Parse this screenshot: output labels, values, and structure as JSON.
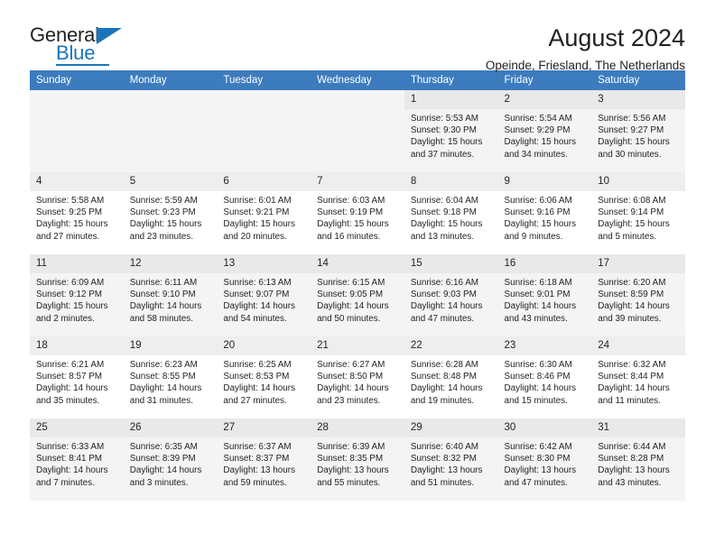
{
  "brand": {
    "name_top": "General",
    "name_bottom": "Blue",
    "accent_color": "#1b75bb",
    "triangle_icon": "triangle-icon"
  },
  "header": {
    "title": "August 2024",
    "subtitle": "Opeinde, Friesland, The Netherlands"
  },
  "calendar": {
    "header_bg": "#3c7cbe",
    "weekday_headers": [
      "Sunday",
      "Monday",
      "Tuesday",
      "Wednesday",
      "Thursday",
      "Friday",
      "Saturday"
    ],
    "weeks": [
      [
        {
          "blank": true
        },
        {
          "blank": true
        },
        {
          "blank": true
        },
        {
          "blank": true
        },
        {
          "day": "1",
          "sunrise": "Sunrise: 5:53 AM",
          "sunset": "Sunset: 9:30 PM",
          "daylight": "Daylight: 15 hours and 37 minutes."
        },
        {
          "day": "2",
          "sunrise": "Sunrise: 5:54 AM",
          "sunset": "Sunset: 9:29 PM",
          "daylight": "Daylight: 15 hours and 34 minutes."
        },
        {
          "day": "3",
          "sunrise": "Sunrise: 5:56 AM",
          "sunset": "Sunset: 9:27 PM",
          "daylight": "Daylight: 15 hours and 30 minutes."
        }
      ],
      [
        {
          "day": "4",
          "sunrise": "Sunrise: 5:58 AM",
          "sunset": "Sunset: 9:25 PM",
          "daylight": "Daylight: 15 hours and 27 minutes."
        },
        {
          "day": "5",
          "sunrise": "Sunrise: 5:59 AM",
          "sunset": "Sunset: 9:23 PM",
          "daylight": "Daylight: 15 hours and 23 minutes."
        },
        {
          "day": "6",
          "sunrise": "Sunrise: 6:01 AM",
          "sunset": "Sunset: 9:21 PM",
          "daylight": "Daylight: 15 hours and 20 minutes."
        },
        {
          "day": "7",
          "sunrise": "Sunrise: 6:03 AM",
          "sunset": "Sunset: 9:19 PM",
          "daylight": "Daylight: 15 hours and 16 minutes."
        },
        {
          "day": "8",
          "sunrise": "Sunrise: 6:04 AM",
          "sunset": "Sunset: 9:18 PM",
          "daylight": "Daylight: 15 hours and 13 minutes."
        },
        {
          "day": "9",
          "sunrise": "Sunrise: 6:06 AM",
          "sunset": "Sunset: 9:16 PM",
          "daylight": "Daylight: 15 hours and 9 minutes."
        },
        {
          "day": "10",
          "sunrise": "Sunrise: 6:08 AM",
          "sunset": "Sunset: 9:14 PM",
          "daylight": "Daylight: 15 hours and 5 minutes."
        }
      ],
      [
        {
          "day": "11",
          "sunrise": "Sunrise: 6:09 AM",
          "sunset": "Sunset: 9:12 PM",
          "daylight": "Daylight: 15 hours and 2 minutes."
        },
        {
          "day": "12",
          "sunrise": "Sunrise: 6:11 AM",
          "sunset": "Sunset: 9:10 PM",
          "daylight": "Daylight: 14 hours and 58 minutes."
        },
        {
          "day": "13",
          "sunrise": "Sunrise: 6:13 AM",
          "sunset": "Sunset: 9:07 PM",
          "daylight": "Daylight: 14 hours and 54 minutes."
        },
        {
          "day": "14",
          "sunrise": "Sunrise: 6:15 AM",
          "sunset": "Sunset: 9:05 PM",
          "daylight": "Daylight: 14 hours and 50 minutes."
        },
        {
          "day": "15",
          "sunrise": "Sunrise: 6:16 AM",
          "sunset": "Sunset: 9:03 PM",
          "daylight": "Daylight: 14 hours and 47 minutes."
        },
        {
          "day": "16",
          "sunrise": "Sunrise: 6:18 AM",
          "sunset": "Sunset: 9:01 PM",
          "daylight": "Daylight: 14 hours and 43 minutes."
        },
        {
          "day": "17",
          "sunrise": "Sunrise: 6:20 AM",
          "sunset": "Sunset: 8:59 PM",
          "daylight": "Daylight: 14 hours and 39 minutes."
        }
      ],
      [
        {
          "day": "18",
          "sunrise": "Sunrise: 6:21 AM",
          "sunset": "Sunset: 8:57 PM",
          "daylight": "Daylight: 14 hours and 35 minutes."
        },
        {
          "day": "19",
          "sunrise": "Sunrise: 6:23 AM",
          "sunset": "Sunset: 8:55 PM",
          "daylight": "Daylight: 14 hours and 31 minutes."
        },
        {
          "day": "20",
          "sunrise": "Sunrise: 6:25 AM",
          "sunset": "Sunset: 8:53 PM",
          "daylight": "Daylight: 14 hours and 27 minutes."
        },
        {
          "day": "21",
          "sunrise": "Sunrise: 6:27 AM",
          "sunset": "Sunset: 8:50 PM",
          "daylight": "Daylight: 14 hours and 23 minutes."
        },
        {
          "day": "22",
          "sunrise": "Sunrise: 6:28 AM",
          "sunset": "Sunset: 8:48 PM",
          "daylight": "Daylight: 14 hours and 19 minutes."
        },
        {
          "day": "23",
          "sunrise": "Sunrise: 6:30 AM",
          "sunset": "Sunset: 8:46 PM",
          "daylight": "Daylight: 14 hours and 15 minutes."
        },
        {
          "day": "24",
          "sunrise": "Sunrise: 6:32 AM",
          "sunset": "Sunset: 8:44 PM",
          "daylight": "Daylight: 14 hours and 11 minutes."
        }
      ],
      [
        {
          "day": "25",
          "sunrise": "Sunrise: 6:33 AM",
          "sunset": "Sunset: 8:41 PM",
          "daylight": "Daylight: 14 hours and 7 minutes."
        },
        {
          "day": "26",
          "sunrise": "Sunrise: 6:35 AM",
          "sunset": "Sunset: 8:39 PM",
          "daylight": "Daylight: 14 hours and 3 minutes."
        },
        {
          "day": "27",
          "sunrise": "Sunrise: 6:37 AM",
          "sunset": "Sunset: 8:37 PM",
          "daylight": "Daylight: 13 hours and 59 minutes."
        },
        {
          "day": "28",
          "sunrise": "Sunrise: 6:39 AM",
          "sunset": "Sunset: 8:35 PM",
          "daylight": "Daylight: 13 hours and 55 minutes."
        },
        {
          "day": "29",
          "sunrise": "Sunrise: 6:40 AM",
          "sunset": "Sunset: 8:32 PM",
          "daylight": "Daylight: 13 hours and 51 minutes."
        },
        {
          "day": "30",
          "sunrise": "Sunrise: 6:42 AM",
          "sunset": "Sunset: 8:30 PM",
          "daylight": "Daylight: 13 hours and 47 minutes."
        },
        {
          "day": "31",
          "sunrise": "Sunrise: 6:44 AM",
          "sunset": "Sunset: 8:28 PM",
          "daylight": "Daylight: 13 hours and 43 minutes."
        }
      ]
    ]
  }
}
